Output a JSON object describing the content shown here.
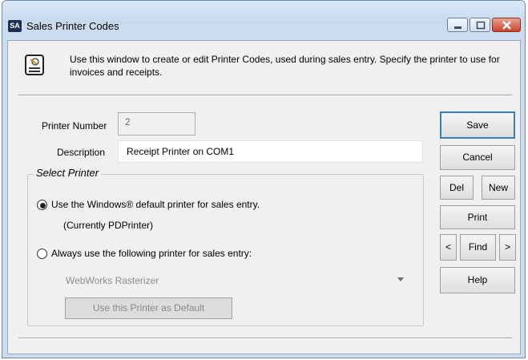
{
  "window": {
    "title": "Sales Printer Codes",
    "app_logo": "SA",
    "controls": [
      "minimize-icon",
      "maximize-icon",
      "close-icon"
    ]
  },
  "info": {
    "icon": "printer-document-icon",
    "text": "Use this window to create or edit Printer Codes, used during sales entry. Specify the printer to use for invoices and receipts."
  },
  "form": {
    "printer_number_label": "Printer Number",
    "printer_number_value": "2",
    "description_label": "Description",
    "description_value": "Receipt Printer on COM1"
  },
  "select_printer": {
    "legend": "Select Printer",
    "option_default_label": "Use the Windows® default printer for sales entry.",
    "option_default_selected": true,
    "current_printer_text": "(Currently PDPrinter)",
    "option_always_label": "Always use the following printer for sales entry:",
    "option_always_selected": false,
    "printer_select_value": "WebWorks Rasterizer",
    "use_default_button": "Use this Printer as Default"
  },
  "buttons": {
    "save": "Save",
    "cancel": "Cancel",
    "del": "Del",
    "new": "New",
    "print": "Print",
    "prev": "<",
    "find": "Find",
    "next": ">",
    "help": "Help"
  }
}
